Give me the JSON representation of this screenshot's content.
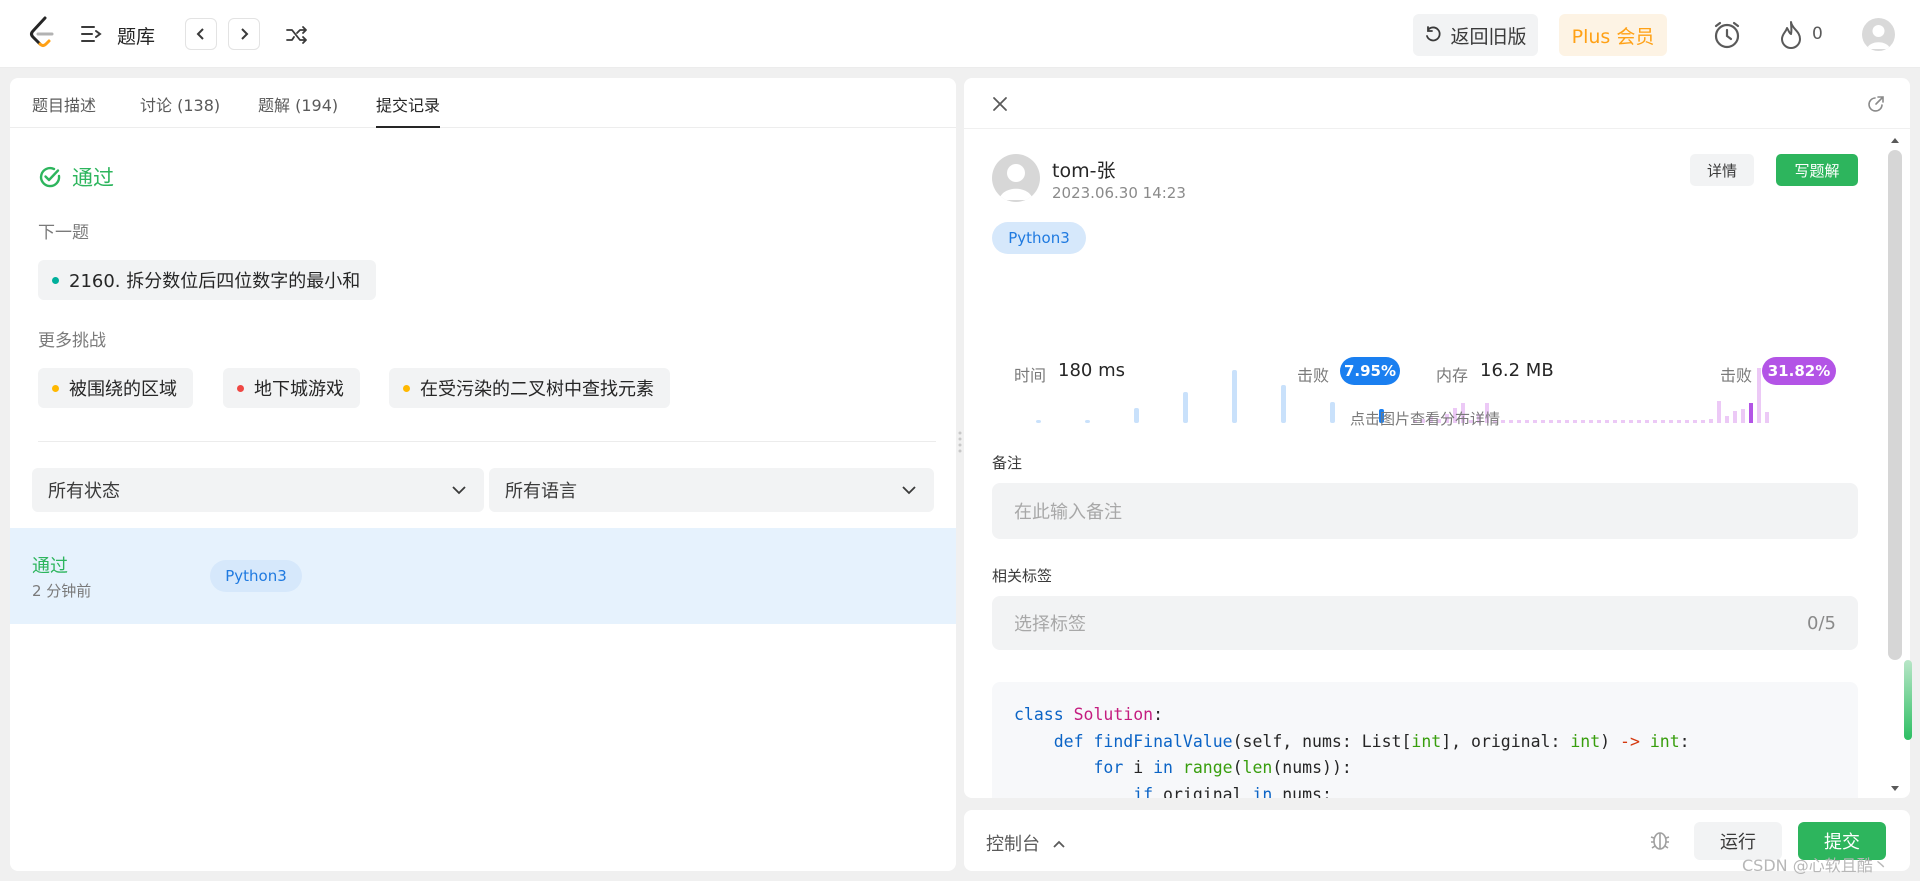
{
  "header": {
    "title": "题库",
    "old_version_label": "返回旧版",
    "plus_label": "Plus 会员",
    "streak_count": "0"
  },
  "left": {
    "tabs": [
      "题目描述",
      "讨论 (138)",
      "题解 (194)",
      "提交记录"
    ],
    "active_tab": "提交记录",
    "status": "通过",
    "next_label": "下一题",
    "next_problem": "2160. 拆分数位后四位数字的最小和",
    "more_label": "更多挑战",
    "challenges": [
      {
        "label": "被围绕的区域",
        "color": "#ffb800"
      },
      {
        "label": "地下城游戏",
        "color": "#ef4743"
      },
      {
        "label": "在受污染的二叉树中查找元素",
        "color": "#ffb800"
      }
    ],
    "filter_status": "所有状态",
    "filter_lang": "所有语言",
    "submission": {
      "status": "通过",
      "time_ago": "2 分钟前",
      "lang": "Python3"
    }
  },
  "right": {
    "user_name": "tom-张",
    "date": "2023.06.30 14:23",
    "detail_label": "详情",
    "write_label": "写题解",
    "lang": "Python3",
    "runtime_label": "时间",
    "runtime_value": "180 ms",
    "beat_label": "击败",
    "runtime_beat": "7.95%",
    "memory_label": "内存",
    "memory_value": "16.2 MB",
    "memory_beat": "31.82%",
    "chart_hint": "点击图片查看分布详情",
    "note_label": "备注",
    "note_placeholder": "在此输入备注",
    "tags_label": "相关标签",
    "tags_placeholder": "选择标签",
    "tags_count": "0/5",
    "code_lines": [
      "class Solution:",
      "    def findFinalValue(self, nums: List[int], original: int) -> int:",
      "        for i in range(len(nums)):",
      "            if original in nums:"
    ]
  },
  "bottom": {
    "console_label": "控制台",
    "run_label": "运行",
    "submit_label": "提交"
  },
  "watermark": "CSDN @心软且酷丶",
  "colors": {
    "accent_green": "#2db55d",
    "plus_orange": "#ffa116",
    "runtime_blue": "#1a7ff0",
    "memory_purple": "#b354e6"
  }
}
